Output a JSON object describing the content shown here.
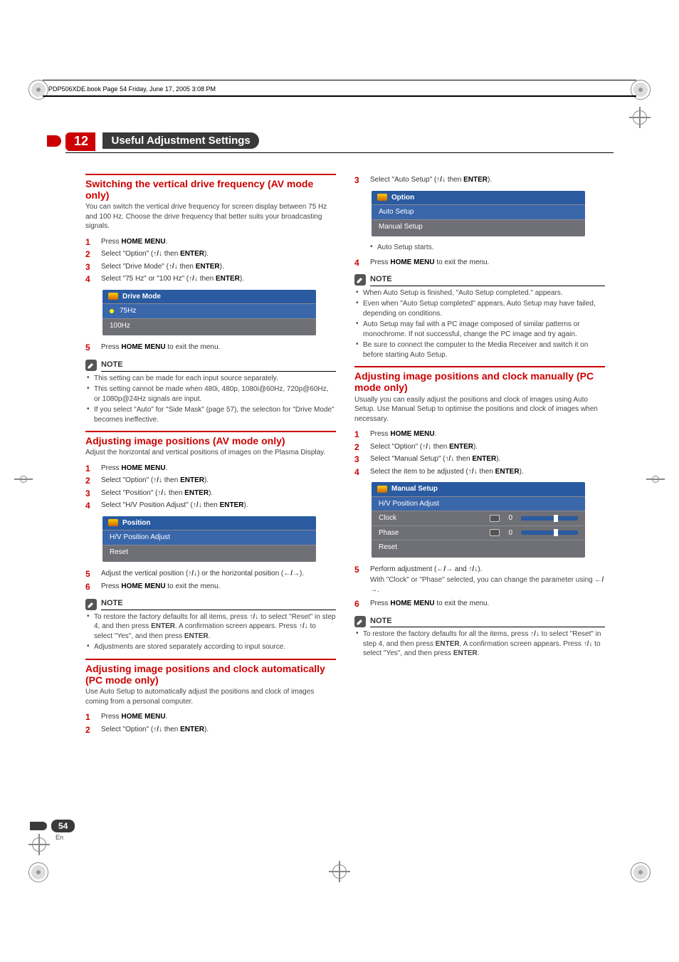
{
  "file_bar": "PDP506XDE.book  Page 54  Friday, June 17, 2005  3:08 PM",
  "chapter": {
    "num": "12",
    "title": "Useful Adjustment Settings"
  },
  "page": {
    "num": "54",
    "lang": "En"
  },
  "left": {
    "s1": {
      "title": "Switching the vertical drive frequency (AV mode only)",
      "sub": "You can switch the vertical drive frequency for screen display between 75 Hz and 100 Hz. Choose the drive frequency that better suits your broadcasting signals.",
      "step1": "Press ",
      "step1b": "HOME MENU",
      "step1c": ".",
      "step2a": "Select \"Option\" (",
      "step2b": " then ",
      "step2c": "ENTER",
      "step2d": ").",
      "step3a": "Select \"Drive Mode\" (",
      "step3b": " then ",
      "step3c": "ENTER",
      "step3d": ").",
      "step4a": "Select \"75 Hz\" or \"100 Hz\" (",
      "step4b": " then ",
      "step4c": "ENTER",
      "step4d": ").",
      "step5a": "Press ",
      "step5b": "HOME MENU",
      "step5c": " to exit the menu.",
      "osd_title": "Drive Mode",
      "osd_r1": "75Hz",
      "osd_r2": "100Hz",
      "note_label": "NOTE",
      "n1": "This setting can be made for each input source separately.",
      "n2": "This setting cannot be made when 480i, 480p, 1080i@60Hz, 720p@60Hz, or 1080p@24Hz signals are input.",
      "n3": "If you select \"Auto\" for \"Side Mask\" (page 57), the selection for \"Drive Mode\" becomes ineffective."
    },
    "s2": {
      "title": "Adjusting image positions (AV mode only)",
      "sub": "Adjust the horizontal and vertical positions of images on the Plasma Display.",
      "step1": "Press ",
      "step1b": "HOME MENU",
      "step1c": ".",
      "step2a": "Select \"Option\" (",
      "step2b": " then ",
      "step2c": "ENTER",
      "step2d": ").",
      "step3a": "Select \"Position\" (",
      "step3b": " then ",
      "step3c": "ENTER",
      "step3d": ").",
      "step4a": "Select \"H/V Position Adjust\" (",
      "step4b": " then ",
      "step4c": "ENTER",
      "step4d": ").",
      "osd_title": "Position",
      "osd_r1": "H/V Position Adjust",
      "osd_r2": "Reset",
      "step5a": "Adjust the vertical position (",
      "step5b": ") or the horizontal position  (",
      "step5c": ").",
      "step6a": "Press ",
      "step6b": "HOME MENU",
      "step6c": " to exit the menu.",
      "note_label": "NOTE",
      "n1a": "To restore the factory defaults for all items, press ",
      "n1b": " to select \"Reset\" in step 4, and then press ",
      "n1c": "ENTER",
      "n1d": ". A confirmation screen appears. Press ",
      "n1e": " to select \"Yes\", and then press ",
      "n1f": "ENTER",
      "n1g": ".",
      "n2": "Adjustments are stored separately according to input source."
    },
    "s3": {
      "title": "Adjusting image positions and clock automatically (PC mode only)",
      "sub": "Use Auto Setup to automatically adjust the positions and clock of images coming from a personal computer.",
      "step1": "Press ",
      "step1b": "HOME MENU",
      "step1c": ".",
      "step2a": "Select \"Option\" (",
      "step2b": " then ",
      "step2c": "ENTER",
      "step2d": ")."
    }
  },
  "right": {
    "cont": {
      "step3a": "Select \"Auto Setup\" (",
      "step3b": " then ",
      "step3c": "ENTER",
      "step3d": ").",
      "osd_title": "Option",
      "osd_r1": "Auto Setup",
      "osd_r2": "Manual Setup",
      "bullet": "Auto Setup starts.",
      "step4a": "Press ",
      "step4b": "HOME MENU",
      "step4c": " to exit the menu.",
      "note_label": "NOTE",
      "n1": "When Auto Setup is finished, \"Auto Setup completed.\" appears.",
      "n2": "Even when \"Auto Setup completed\" appears, Auto Setup may have failed, depending on conditions.",
      "n3": "Auto Setup may fail with a PC image composed of similar patterns or monochrome. If not successful, change the PC image and try again.",
      "n4": "Be sure to connect the computer to the Media Receiver and switch it on before starting Auto Setup."
    },
    "s4": {
      "title": "Adjusting image positions and clock manually (PC mode only)",
      "sub": "Usually you can easily adjust the positions and clock of images using Auto Setup. Use Manual Setup to optimise the positions and clock of images when necessary.",
      "step1": "Press ",
      "step1b": "HOME MENU",
      "step1c": ".",
      "step2a": "Select \"Option\" (",
      "step2b": " then ",
      "step2c": "ENTER",
      "step2d": ").",
      "step3a": "Select \"Manual Setup\" (",
      "step3b": " then ",
      "step3c": "ENTER",
      "step3d": ").",
      "step4a": "Select the item to be adjusted (",
      "step4b": " then ",
      "step4c": "ENTER",
      "step4d": ").",
      "osd_title": "Manual Setup",
      "osd_r1": "H/V Position Adjust",
      "osd_r2": "Clock",
      "osd_r3": "Phase",
      "osd_r4": "Reset",
      "osd_val": "0",
      "step5a": "Perform adjustment (",
      "step5b": " and ",
      "step5c": ").",
      "step5sub": "With \"Clock\" or \"Phase\" selected, you can change the parameter using ",
      "step5sub2": ".",
      "step6a": "Press ",
      "step6b": "HOME MENU",
      "step6c": " to exit the menu.",
      "note_label": "NOTE",
      "n1a": "To restore the factory defaults for all the items, press ",
      "n1b": " to select \"Reset\" in step 4, and then press ",
      "n1c": "ENTER",
      "n1d": ". A confirmation screen appears. Press ",
      "n1e": " to select \"Yes\", and then press ",
      "n1f": "ENTER",
      "n1g": "."
    }
  },
  "glyph": {
    "updown": "↑/↓",
    "leftright": "←/→"
  }
}
